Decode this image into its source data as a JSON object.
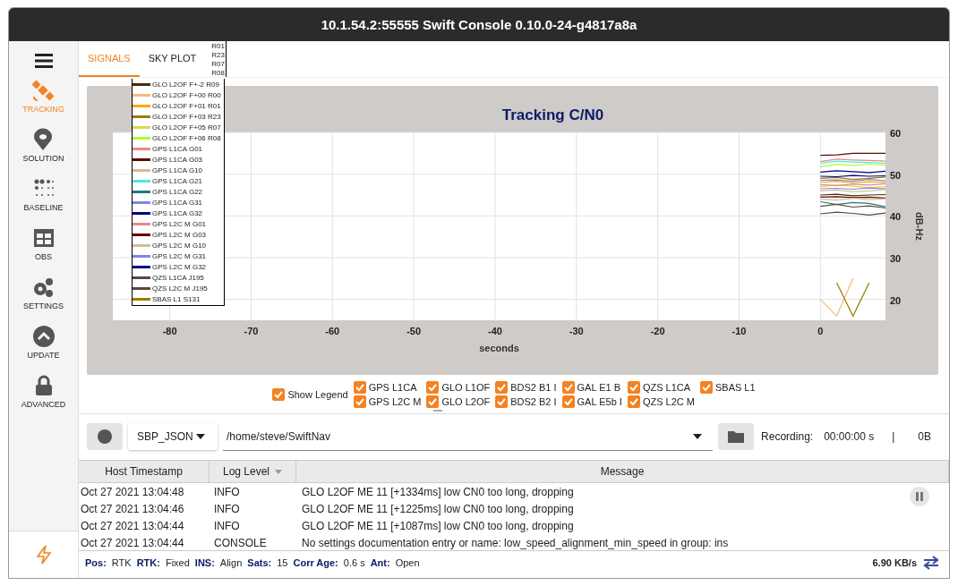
{
  "window": {
    "title": "10.1.54.2:55555 Swift Console 0.10.0-24-g4817a8a"
  },
  "sidebar": {
    "items": [
      {
        "label": "TRACKING",
        "selected": true
      },
      {
        "label": "SOLUTION",
        "selected": false
      },
      {
        "label": "BASELINE",
        "selected": false
      },
      {
        "label": "OBS",
        "selected": false
      },
      {
        "label": "SETTINGS",
        "selected": false
      },
      {
        "label": "UPDATE",
        "selected": false
      },
      {
        "label": "ADVANCED",
        "selected": false
      }
    ]
  },
  "tabs": [
    {
      "label": "SIGNALS",
      "selected": true
    },
    {
      "label": "SKY PLOT",
      "selected": false
    }
  ],
  "chart": {
    "legend_overflow": [
      "R01",
      "R23",
      "R07",
      "R08"
    ],
    "chart_data": {
      "type": "line",
      "grid": true,
      "title": "Tracking C/N0",
      "xlabel": "seconds",
      "ylabel": "dB-Hz",
      "xlim": [
        -87,
        8
      ],
      "ylim": [
        15,
        60
      ],
      "xticks": [
        -80,
        -70,
        -60,
        -50,
        -40,
        -30,
        -20,
        -10,
        0
      ],
      "yticks": [
        20,
        30,
        40,
        50,
        60
      ],
      "x": [
        0,
        2,
        4,
        6,
        8
      ],
      "series": [
        {
          "name": "GLO L2OF F+-2 R09",
          "color": "#4a2a0a",
          "values": [
            45,
            45.2,
            44.8,
            45,
            45.1
          ]
        },
        {
          "name": "GLO L2OF F+00 R00",
          "color": "#f4b97a",
          "values": [
            20,
            16,
            25,
            null,
            null
          ]
        },
        {
          "name": "GLO L2OF F+01 R01",
          "color": "#ffa500",
          "values": [
            48,
            48.3,
            47.9,
            48.2,
            48
          ]
        },
        {
          "name": "GLO L2OF F+03 R23",
          "color": "#9c7c00",
          "values": [
            49,
            49.2,
            48.7,
            49,
            49.3
          ]
        },
        {
          "name": "GLO L2OF F+05 R07",
          "color": "#cfdc4c",
          "values": [
            47,
            47.4,
            47.1,
            46.8,
            47
          ]
        },
        {
          "name": "GLO L2OF F+06 R08",
          "color": "#adff2f",
          "values": [
            51.8,
            52.3,
            52.1,
            52.4,
            52.2
          ]
        },
        {
          "name": "GPS L1CA G01",
          "color": "#e88a8a",
          "values": [
            53,
            53.6,
            53.4,
            53.3,
            53.1
          ]
        },
        {
          "name": "GPS L1CA G03",
          "color": "#5a0a00",
          "values": [
            54.5,
            54.6,
            55,
            55,
            55
          ]
        },
        {
          "name": "GPS L1CA G10",
          "color": "#d2bd96",
          "values": [
            46,
            46.2,
            45.8,
            46,
            46.3
          ]
        },
        {
          "name": "GPS L1CA G21",
          "color": "#4fe8e0",
          "values": [
            52.6,
            53.1,
            52.9,
            52.8,
            52.6
          ]
        },
        {
          "name": "GPS L1CA G22",
          "color": "#1e7b7b",
          "values": [
            43.4,
            42.7,
            43.2,
            43,
            42.2
          ]
        },
        {
          "name": "GPS L1CA G31",
          "color": "#8088dd",
          "values": [
            48.5,
            48.6,
            48.3,
            48.7,
            48.4
          ]
        },
        {
          "name": "GPS L1CA G32",
          "color": "#000080",
          "values": [
            50.5,
            50.8,
            50.6,
            50.4,
            50.7
          ]
        },
        {
          "name": "GPS L2C M G01",
          "color": "#e88a8a",
          "values": [
            47.5,
            47.3,
            47.6,
            47.4,
            47.7
          ]
        },
        {
          "name": "GPS L2C M G03",
          "color": "#5a0a00",
          "values": [
            44.5,
            44.6,
            44.4,
            44.5,
            44.3
          ]
        },
        {
          "name": "GPS L2C M G10",
          "color": "#d2bd96",
          "values": [
            44,
            43.8,
            44.2,
            43.9,
            44.1
          ]
        },
        {
          "name": "GPS L2C M G31",
          "color": "#8088dd",
          "values": [
            46.5,
            46.6,
            46.4,
            46.7,
            46.5
          ]
        },
        {
          "name": "GPS L2C M G32",
          "color": "#000080",
          "values": [
            49.5,
            49.4,
            49.7,
            49.5,
            49.6
          ]
        },
        {
          "name": "QZS L1CA J195",
          "color": "#5e4444",
          "values": [
            42.3,
            42.8,
            42.1,
            42.4,
            41.9
          ]
        },
        {
          "name": "QZS L2C M J195",
          "color": "#5e4444",
          "values": [
            40.5,
            40.9,
            40.6,
            40.2,
            40.7
          ]
        },
        {
          "name": "SBAS L1 S131",
          "color": "#9c7c00",
          "values": [
            null,
            24,
            16,
            24,
            null
          ]
        }
      ]
    }
  },
  "filters": {
    "show_legend": {
      "label": "Show Legend",
      "checked": true
    },
    "signals": [
      {
        "label": "GPS L1CA",
        "checked": true
      },
      {
        "label": "GLO L1OF",
        "checked": true
      },
      {
        "label": "BDS2 B1 I",
        "checked": true
      },
      {
        "label": "GAL E1 B",
        "checked": true
      },
      {
        "label": "QZS L1CA",
        "checked": true
      },
      {
        "label": "SBAS L1",
        "checked": true
      },
      {
        "label": "GPS L2C M",
        "checked": true
      },
      {
        "label": "GLO L2OF",
        "checked": true
      },
      {
        "label": "BDS2 B2 I",
        "checked": true
      },
      {
        "label": "GAL E5b I",
        "checked": true
      },
      {
        "label": "QZS L2C M",
        "checked": true
      }
    ]
  },
  "recording": {
    "format": "SBP_JSON",
    "path": "/home/steve/SwiftNav",
    "label": "Recording:",
    "time": "00:00:00 s",
    "separator": "|",
    "size": "0B"
  },
  "log": {
    "columns": [
      "Host Timestamp",
      "Log Level",
      "Message"
    ],
    "rows": [
      [
        "Oct 27 2021 13:04:48",
        "INFO",
        "GLO L2OF ME 11 [+1334ms] low CN0 too long, dropping"
      ],
      [
        "Oct 27 2021 13:04:46",
        "INFO",
        "GLO L2OF ME 11 [+1225ms] low CN0 too long, dropping"
      ],
      [
        "Oct 27 2021 13:04:44",
        "INFO",
        "GLO L2OF ME 11 [+1087ms] low CN0 too long, dropping"
      ],
      [
        "Oct 27 2021 13:04:44",
        "CONSOLE",
        "No settings documentation entry or name: low_speed_alignment_min_speed in group: ins"
      ]
    ]
  },
  "status_bar": {
    "items": [
      {
        "label": "Pos:",
        "value": "RTK"
      },
      {
        "label": "RTK:",
        "value": "Fixed"
      },
      {
        "label": "INS:",
        "value": "Align"
      },
      {
        "label": "Sats:",
        "value": "15"
      },
      {
        "label": "Corr Age:",
        "value": "0.6 s"
      },
      {
        "label": "Ant:",
        "value": "Open"
      }
    ],
    "rate": "6.90 KB/s"
  }
}
